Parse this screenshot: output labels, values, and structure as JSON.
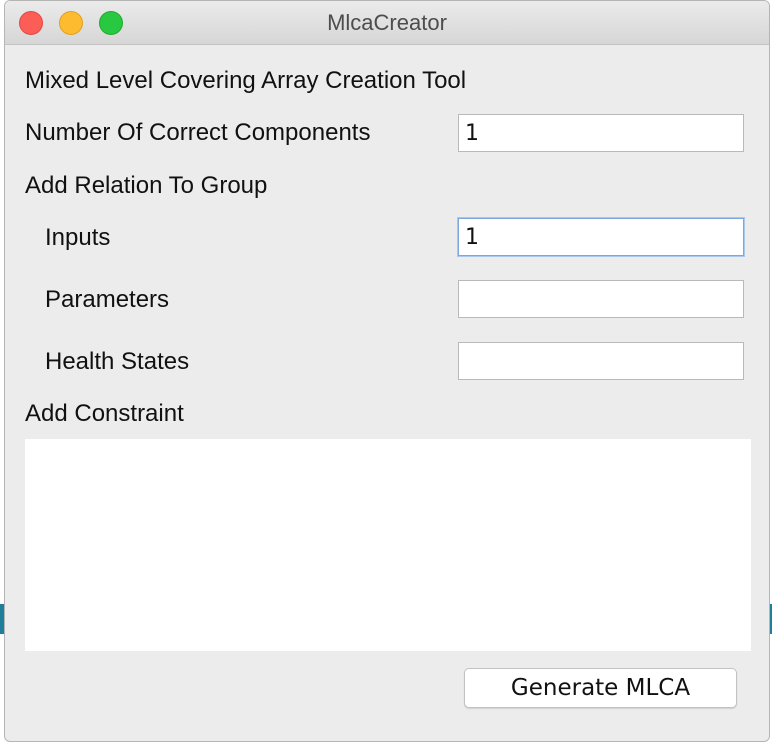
{
  "window": {
    "title": "MlcaCreator",
    "controls": [
      "close",
      "minimize",
      "zoom"
    ]
  },
  "form": {
    "heading": "Mixed Level Covering Array Creation Tool",
    "correct_components": {
      "label": "Number Of Correct Components",
      "value": "1"
    },
    "relation_heading": "Add Relation To Group",
    "inputs": {
      "label": "Inputs",
      "value": "1"
    },
    "parameters": {
      "label": "Parameters",
      "value": ""
    },
    "health_states": {
      "label": "Health States",
      "value": ""
    },
    "constraint_heading": "Add Constraint",
    "constraint_text": ""
  },
  "actions": {
    "generate_label": "Generate MLCA"
  },
  "colors": {
    "window_bg": "#ececec",
    "focus_ring": "#7aa7dd",
    "close": "#fc5d56",
    "minimize": "#fdbc2f",
    "zoom": "#28c840"
  }
}
